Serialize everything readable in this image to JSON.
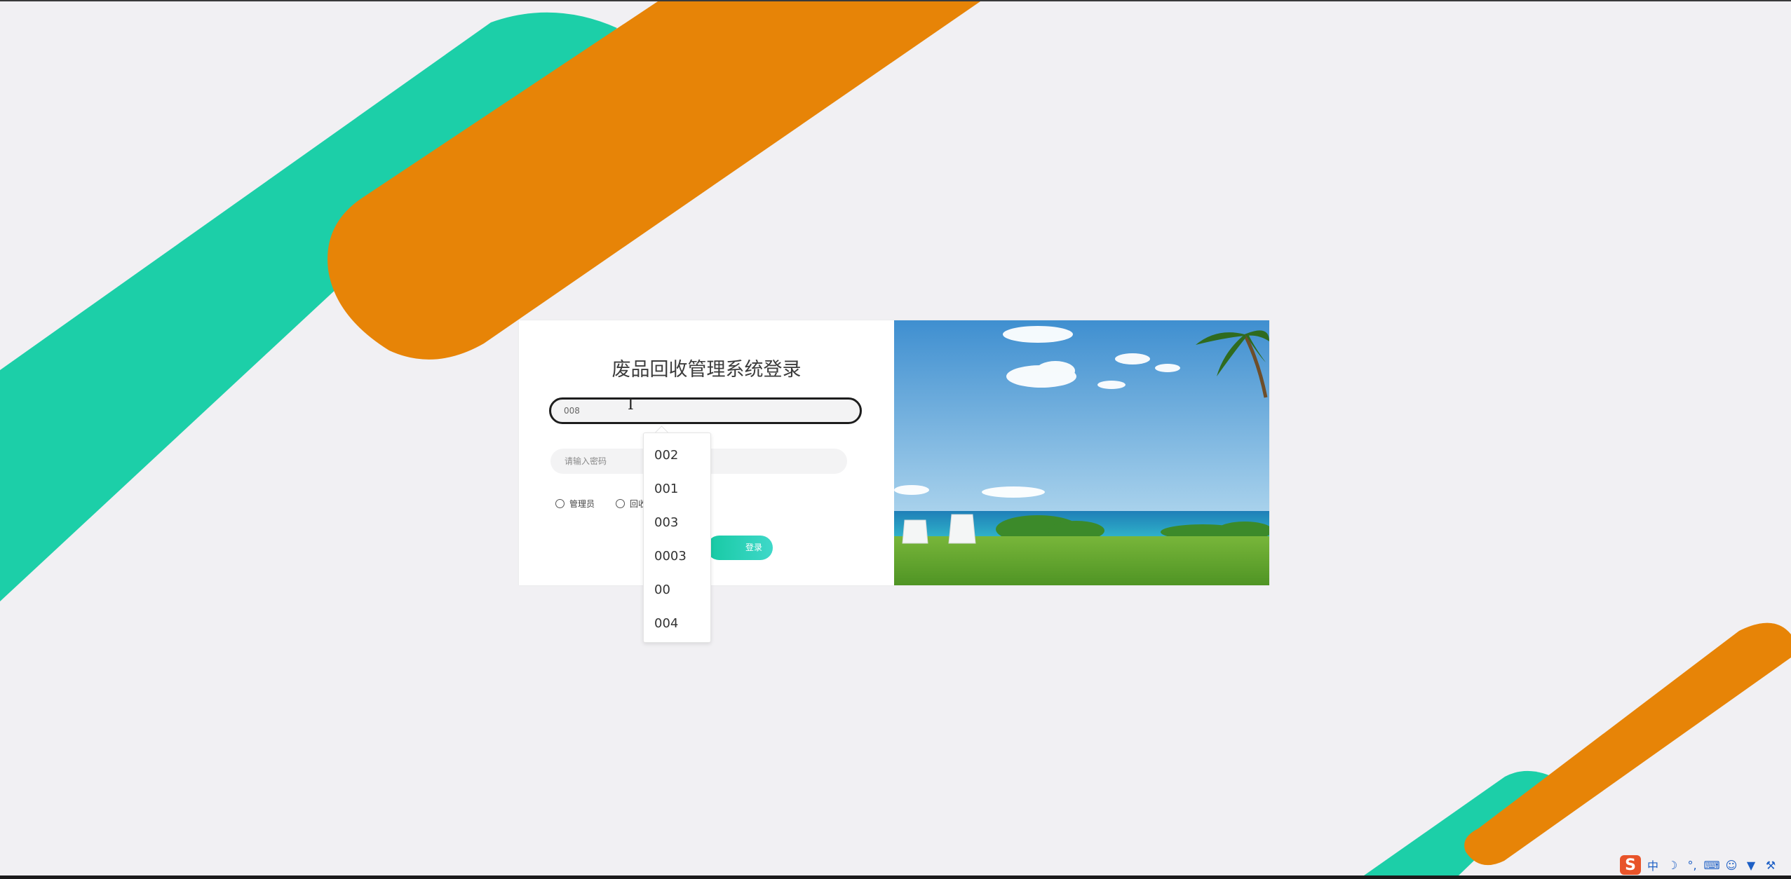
{
  "login": {
    "title": "废品回收管理系统登录",
    "username_value": "008",
    "password_placeholder": "请输入密码",
    "roles": [
      "管理员",
      "回收员"
    ],
    "submit_label": "登录"
  },
  "autocomplete": {
    "options": [
      "002",
      "001",
      "003",
      "0003",
      "00",
      "004"
    ]
  },
  "tray": {
    "ime_mode": "中"
  },
  "colors": {
    "teal": "#1ccfa8",
    "orange": "#e78407",
    "page_bg": "#f1f0f3",
    "button": "#16c9a3"
  }
}
